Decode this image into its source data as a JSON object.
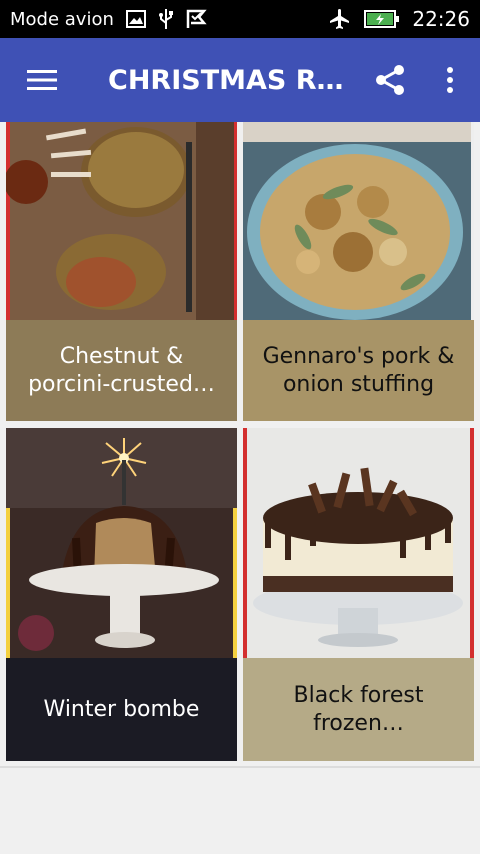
{
  "status_bar": {
    "airplane_text": "Mode avion",
    "time": "22:26",
    "icons": [
      "image-icon",
      "usb-icon",
      "check-flag-icon",
      "airplane-icon",
      "battery-charging-icon"
    ]
  },
  "app_bar": {
    "title": "CHRISTMAS R…",
    "menu_icon": "hamburger-menu-icon",
    "share_icon": "share-icon",
    "overflow_icon": "more-vertical-icon",
    "color": "#3f51b5"
  },
  "recipes": [
    {
      "title": "Chestnut & porcini-crusted…",
      "caption_color": "#8d7b57"
    },
    {
      "title": "Gennaro's pork & onion stuffing",
      "caption_color": "#a89467"
    },
    {
      "title": "Winter bombe",
      "caption_color": "#1b1b24"
    },
    {
      "title": "Black forest frozen…",
      "caption_color": "#b5aa87"
    }
  ]
}
